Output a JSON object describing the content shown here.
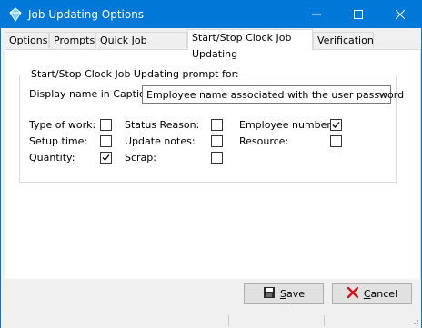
{
  "window": {
    "title": "Job Updating Options",
    "accent": "#0078d7",
    "controls": [
      "minimize-icon",
      "maximize-icon",
      "close-icon"
    ]
  },
  "tabs": [
    {
      "prefix": "",
      "hotkey": "O",
      "rest": "ptions",
      "active": false
    },
    {
      "prefix": "",
      "hotkey": "P",
      "rest": "rompts",
      "active": false
    },
    {
      "prefix": "",
      "hotkey": "Q",
      "rest": "uick Job Updating",
      "active": false
    },
    {
      "prefix": "Start/Stop Clock Job Updating",
      "hotkey": "",
      "rest": "",
      "active": true
    },
    {
      "prefix": "",
      "hotkey": "V",
      "rest": "erification",
      "active": false
    }
  ],
  "group": {
    "label": "Start/Stop Clock Job Updating prompt for:",
    "caption_label": "Display name in Caption:",
    "caption_value": "Employee name associated with the user password"
  },
  "options": [
    {
      "label": "Type of work:",
      "checked": false
    },
    {
      "label": "Setup time:",
      "checked": false
    },
    {
      "label": "Quantity:",
      "checked": true
    },
    {
      "label": "Status Reason:",
      "checked": false
    },
    {
      "label": "Update notes:",
      "checked": false
    },
    {
      "label": "Scrap:",
      "checked": false
    },
    {
      "label": "Employee number:",
      "checked": true
    },
    {
      "label": "Resource:",
      "checked": false
    }
  ],
  "buttons": {
    "save": {
      "hotkey": "S",
      "rest": "ave",
      "icon": "floppy-disk-icon"
    },
    "cancel": {
      "hotkey": "C",
      "rest": "ancel",
      "icon": "red-x-icon"
    }
  }
}
